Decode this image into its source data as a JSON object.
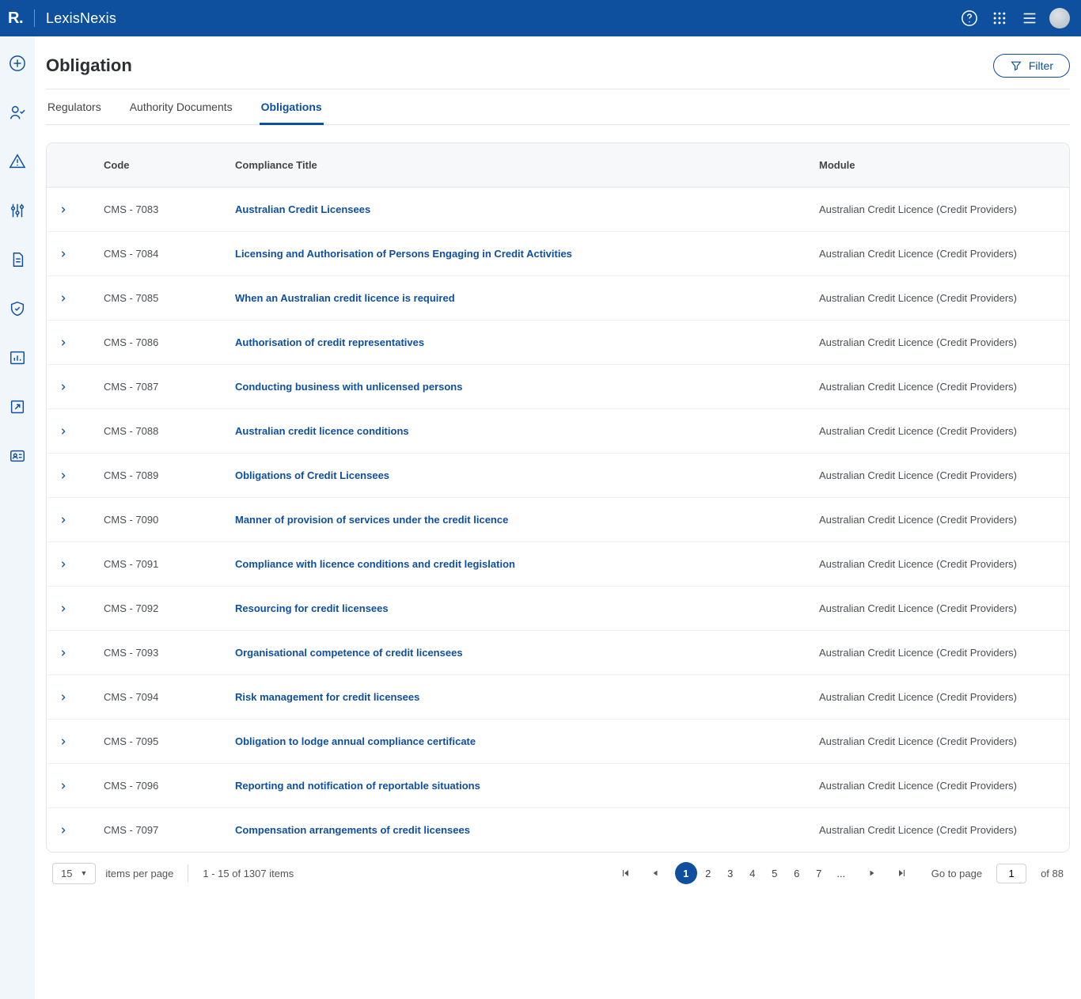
{
  "header": {
    "logo_text": "R.",
    "brand": "LexisNexis"
  },
  "page": {
    "title": "Obligation",
    "filter_label": "Filter"
  },
  "tabs": [
    {
      "label": "Regulators",
      "active": false
    },
    {
      "label": "Authority Documents",
      "active": false
    },
    {
      "label": "Obligations",
      "active": true
    }
  ],
  "table": {
    "columns": {
      "code": "Code",
      "title": "Compliance Title",
      "module": "Module"
    },
    "rows": [
      {
        "code": "CMS - 7083",
        "title": "Australian Credit Licensees",
        "module": "Australian Credit Licence (Credit Providers)"
      },
      {
        "code": "CMS - 7084",
        "title": "Licensing and Authorisation of Persons Engaging in Credit Activities",
        "module": "Australian Credit Licence (Credit Providers)"
      },
      {
        "code": "CMS - 7085",
        "title": "When an Australian credit licence is required",
        "module": "Australian Credit Licence (Credit Providers)"
      },
      {
        "code": "CMS - 7086",
        "title": "Authorisation of credit representatives",
        "module": "Australian Credit Licence (Credit Providers)"
      },
      {
        "code": "CMS - 7087",
        "title": "Conducting business with unlicensed persons",
        "module": "Australian Credit Licence (Credit Providers)"
      },
      {
        "code": "CMS - 7088",
        "title": "Australian credit licence conditions",
        "module": "Australian Credit Licence (Credit Providers)"
      },
      {
        "code": "CMS - 7089",
        "title": "Obligations of Credit Licensees",
        "module": "Australian Credit Licence (Credit Providers)"
      },
      {
        "code": "CMS - 7090",
        "title": "Manner of provision of services under the credit licence",
        "module": "Australian Credit Licence (Credit Providers)"
      },
      {
        "code": "CMS - 7091",
        "title": "Compliance with licence conditions and credit legislation",
        "module": "Australian Credit Licence (Credit Providers)"
      },
      {
        "code": "CMS - 7092",
        "title": "Resourcing for credit licensees",
        "module": "Australian Credit Licence (Credit Providers)"
      },
      {
        "code": "CMS - 7093",
        "title": "Organisational competence of credit licensees",
        "module": "Australian Credit Licence (Credit Providers)"
      },
      {
        "code": "CMS - 7094",
        "title": "Risk management for credit licensees",
        "module": "Australian Credit Licence (Credit Providers)"
      },
      {
        "code": "CMS - 7095",
        "title": "Obligation to lodge annual compliance certificate",
        "module": "Australian Credit Licence (Credit Providers)"
      },
      {
        "code": "CMS - 7096",
        "title": "Reporting and notification of reportable situations",
        "module": "Australian Credit Licence (Credit Providers)"
      },
      {
        "code": "CMS - 7097",
        "title": "Compensation arrangements of credit licensees",
        "module": "Australian Credit Licence (Credit Providers)"
      }
    ]
  },
  "pagination": {
    "page_size": "15",
    "items_per_page_label": "items per page",
    "range_text": "1 - 15 of 1307 items",
    "pages": [
      "1",
      "2",
      "3",
      "4",
      "5",
      "6",
      "7",
      "..."
    ],
    "current_page": "1",
    "goto_label": "Go to page",
    "goto_value": "1",
    "total_pages_text": "of 88"
  }
}
